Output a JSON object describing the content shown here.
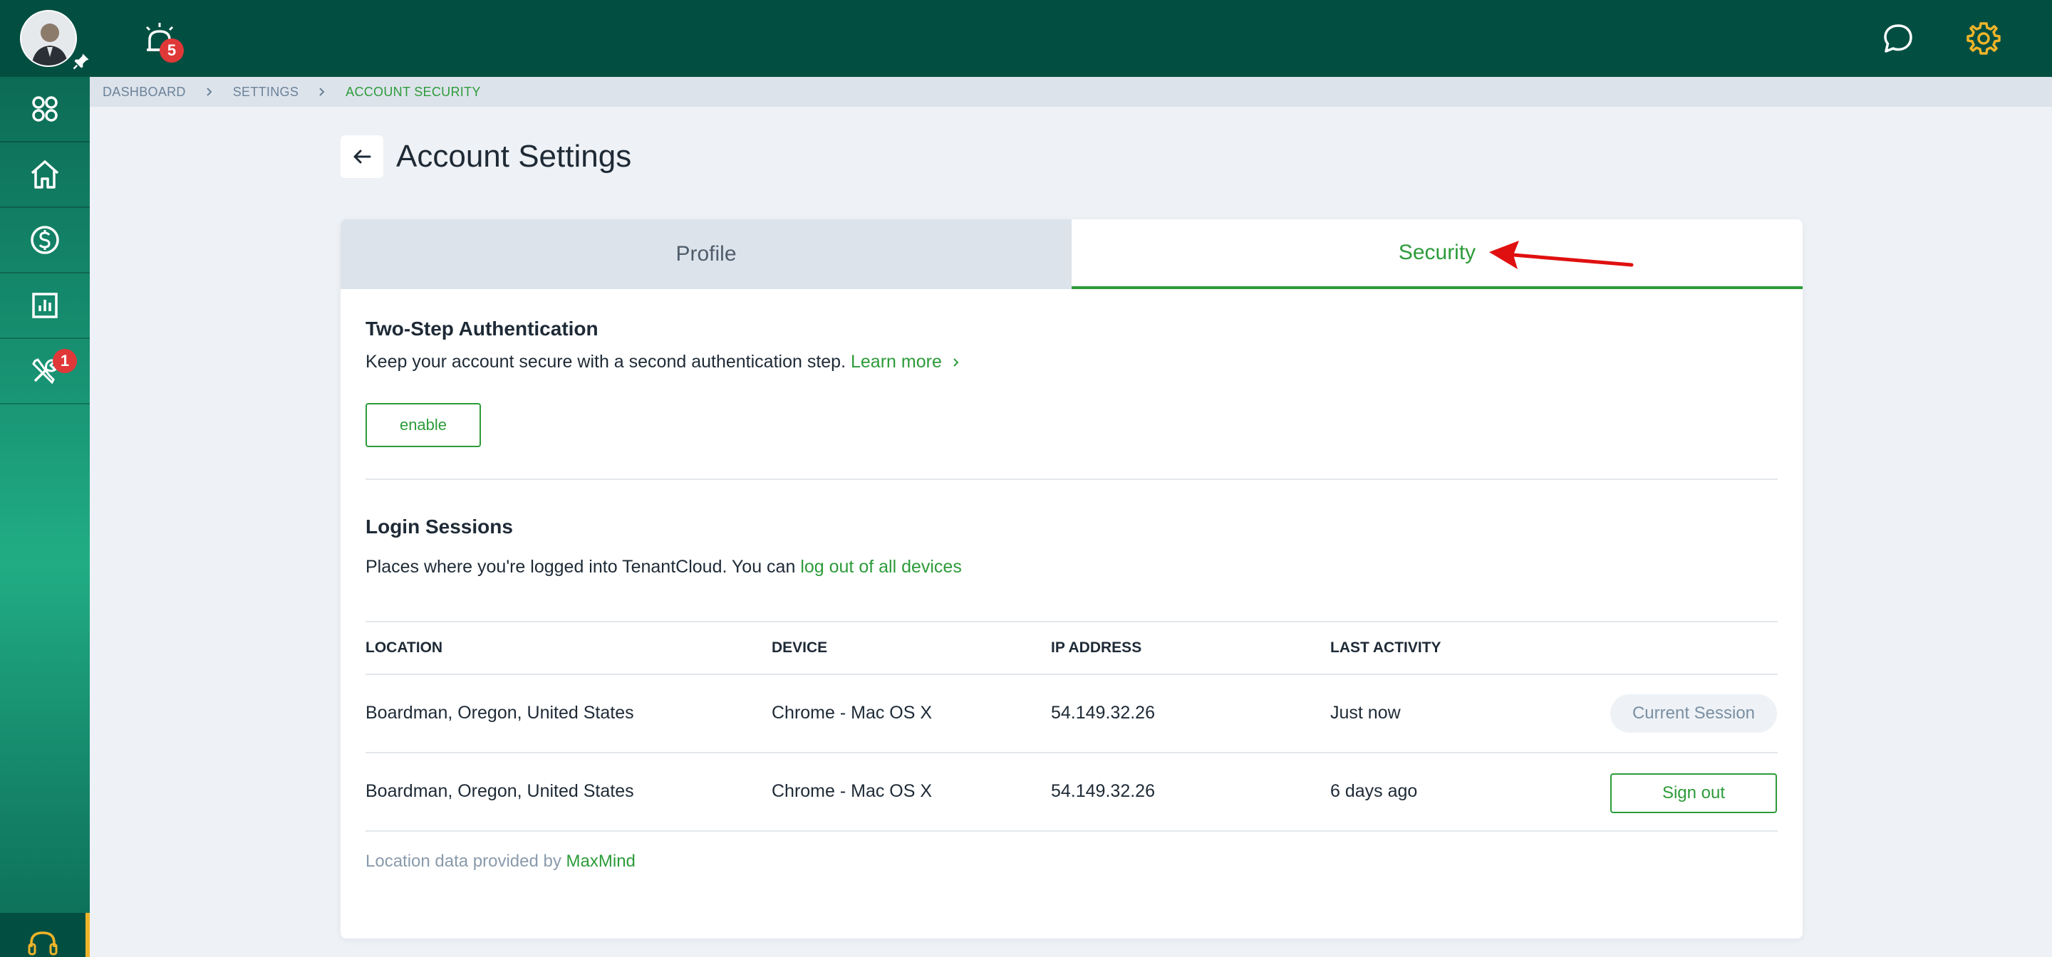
{
  "topbar": {
    "alerts_count": "5",
    "colors": {
      "bg": "#024f42",
      "gear": "#f0b429"
    }
  },
  "sidebar": {
    "items": [
      {
        "icon": "apps-grid-icon"
      },
      {
        "icon": "home-icon"
      },
      {
        "icon": "dollar-icon"
      },
      {
        "icon": "reports-icon"
      },
      {
        "icon": "tools-icon",
        "badge": "1"
      }
    ],
    "support_icon": "headset-icon"
  },
  "breadcrumb": {
    "items": [
      "DASHBOARD",
      "SETTINGS"
    ],
    "active": "ACCOUNT SECURITY"
  },
  "page": {
    "title": "Account Settings"
  },
  "tabs": {
    "profile": "Profile",
    "security": "Security"
  },
  "two_step": {
    "title": "Two-Step Authentication",
    "text": "Keep your account secure with a second authentication step.",
    "learn_more": "Learn more",
    "enable_label": "enable"
  },
  "sessions": {
    "title": "Login Sessions",
    "text": "Places where you're logged into TenantCloud. You can",
    "logout_all": "log out of all devices",
    "headers": {
      "location": "LOCATION",
      "device": "DEVICE",
      "ip": "IP ADDRESS",
      "last": "LAST ACTIVITY"
    },
    "rows": [
      {
        "location": "Boardman, Oregon, United States",
        "device": "Chrome - Mac OS X",
        "ip": "54.149.32.26",
        "last": "Just now",
        "action": "Current Session"
      },
      {
        "location": "Boardman, Oregon, United States",
        "device": "Chrome - Mac OS X",
        "ip": "54.149.32.26",
        "last": "6 days ago",
        "action": "Sign out"
      }
    ],
    "footer": "Location data provided by",
    "footer_link": "MaxMind"
  }
}
